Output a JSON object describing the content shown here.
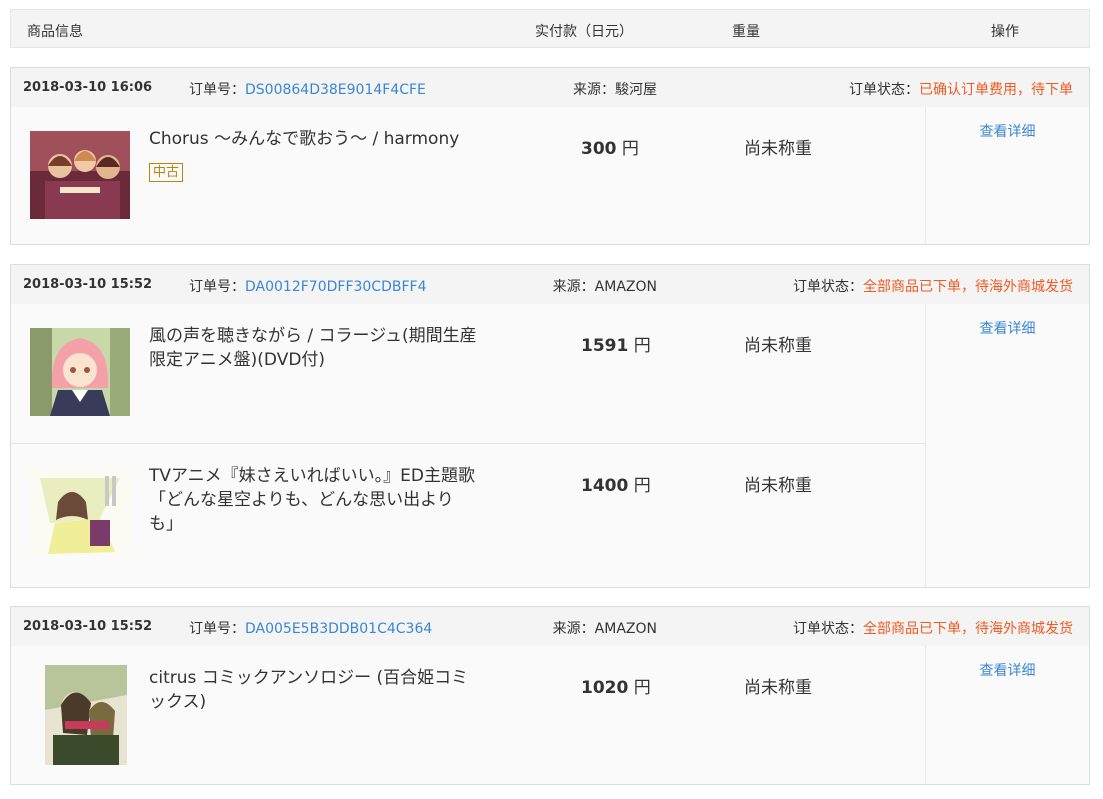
{
  "header": {
    "info": "商品信息",
    "pay": "实付款（日元）",
    "weight": "重量",
    "op": "操作"
  },
  "labels": {
    "order_no": "订单号：",
    "source": "来源：",
    "status": "订单状态：",
    "currency": "円",
    "detail": "查看详细"
  },
  "orders": [
    {
      "date": "2018-03-10 16:06",
      "order_no": "DS00864D38E9014F4CFE",
      "source": "駿河屋",
      "status": "已确认订单费用，待下单",
      "items": [
        {
          "title": "Chorus ～みんなで歌おう～ / harmony",
          "tag": "中古",
          "price": "300",
          "weight": "尚未称重"
        }
      ]
    },
    {
      "date": "2018-03-10 15:52",
      "order_no": "DA0012F70DFF30CDBFF4",
      "source": "AMAZON",
      "status": "全部商品已下单，待海外商城发货",
      "items": [
        {
          "title": "風の声を聴きながら / コラージュ(期間生産限定アニメ盤)(DVD付)",
          "price": "1591",
          "weight": "尚未称重"
        },
        {
          "title": "TVアニメ『妹さえいればいい。』ED主題歌「どんな星空よりも、どんな思い出よりも」",
          "price": "1400",
          "weight": "尚未称重"
        }
      ]
    },
    {
      "date": "2018-03-10 15:52",
      "order_no": "DA005E5B3DDB01C4C364",
      "source": "AMAZON",
      "status": "全部商品已下单，待海外商城发货",
      "items": [
        {
          "title": "citrus コミックアンソロジー (百合姫コミックス)",
          "price": "1020",
          "weight": "尚未称重"
        }
      ]
    }
  ]
}
